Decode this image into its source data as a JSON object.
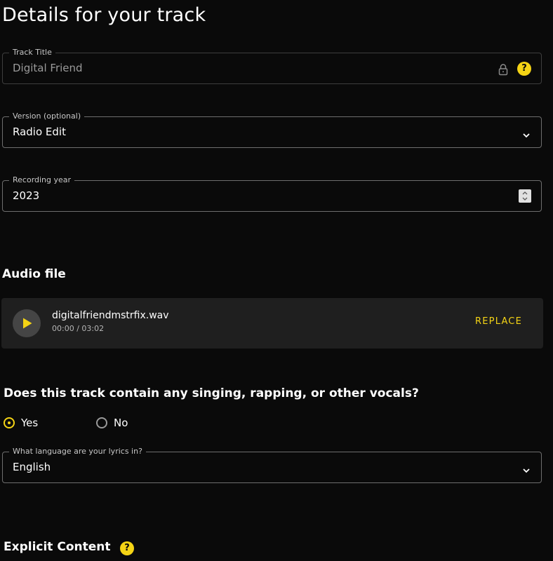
{
  "page": {
    "title": "Details for your track"
  },
  "track_title": {
    "label": "Track Title",
    "value": "Digital Friend",
    "locked": true,
    "help_icon": "?"
  },
  "version": {
    "label": "Version (optional)",
    "value": "Radio Edit"
  },
  "recording_year": {
    "label": "Recording year",
    "value": "2023"
  },
  "audio": {
    "heading": "Audio file",
    "filename": "digitalfriendmstrfix.wav",
    "time": "00:00 / 03:02",
    "replace_label": "REPLACE"
  },
  "vocals": {
    "question": "Does this track contain any singing, rapping, or other vocals?",
    "options": [
      {
        "label": "Yes",
        "selected": true
      },
      {
        "label": "No",
        "selected": false
      }
    ]
  },
  "lyrics_language": {
    "label": "What language are your lyrics in?",
    "value": "English"
  },
  "explicit": {
    "heading": "Explicit Content",
    "help_icon": "?"
  },
  "colors": {
    "background": "#0a0a0a",
    "accent": "#f5d415",
    "card": "#1f1f1f",
    "border": "#6e6e6e"
  }
}
